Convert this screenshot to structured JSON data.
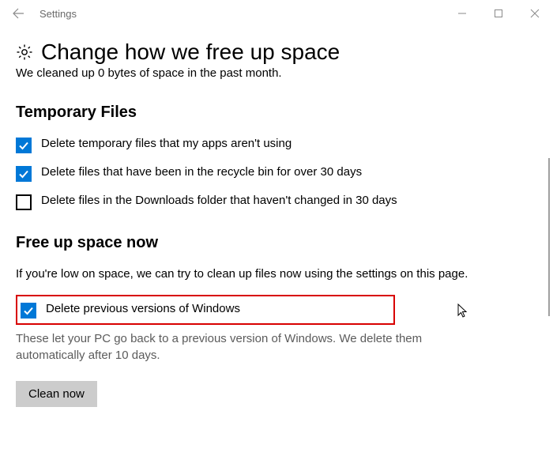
{
  "titlebar": {
    "app_title": "Settings"
  },
  "header": {
    "title": "Change how we free up space",
    "clipped_status": "We cleaned up 0 bytes of space in the past month."
  },
  "temp_files": {
    "heading": "Temporary Files",
    "option1": {
      "label": "Delete temporary files that my apps aren't using",
      "checked": true
    },
    "option2": {
      "label": "Delete files that have been in the recycle bin for over 30 days",
      "checked": true
    },
    "option3": {
      "label": "Delete files in the Downloads folder that haven't changed in 30 days",
      "checked": false
    }
  },
  "free_up_now": {
    "heading": "Free up space now",
    "intro": "If you're low on space, we can try to clean up files now using the settings on this page.",
    "option": {
      "label": "Delete previous versions of Windows",
      "checked": true
    },
    "note": "These let your PC go back to a previous version of Windows. We delete them automatically after 10 days.",
    "button": "Clean now"
  }
}
